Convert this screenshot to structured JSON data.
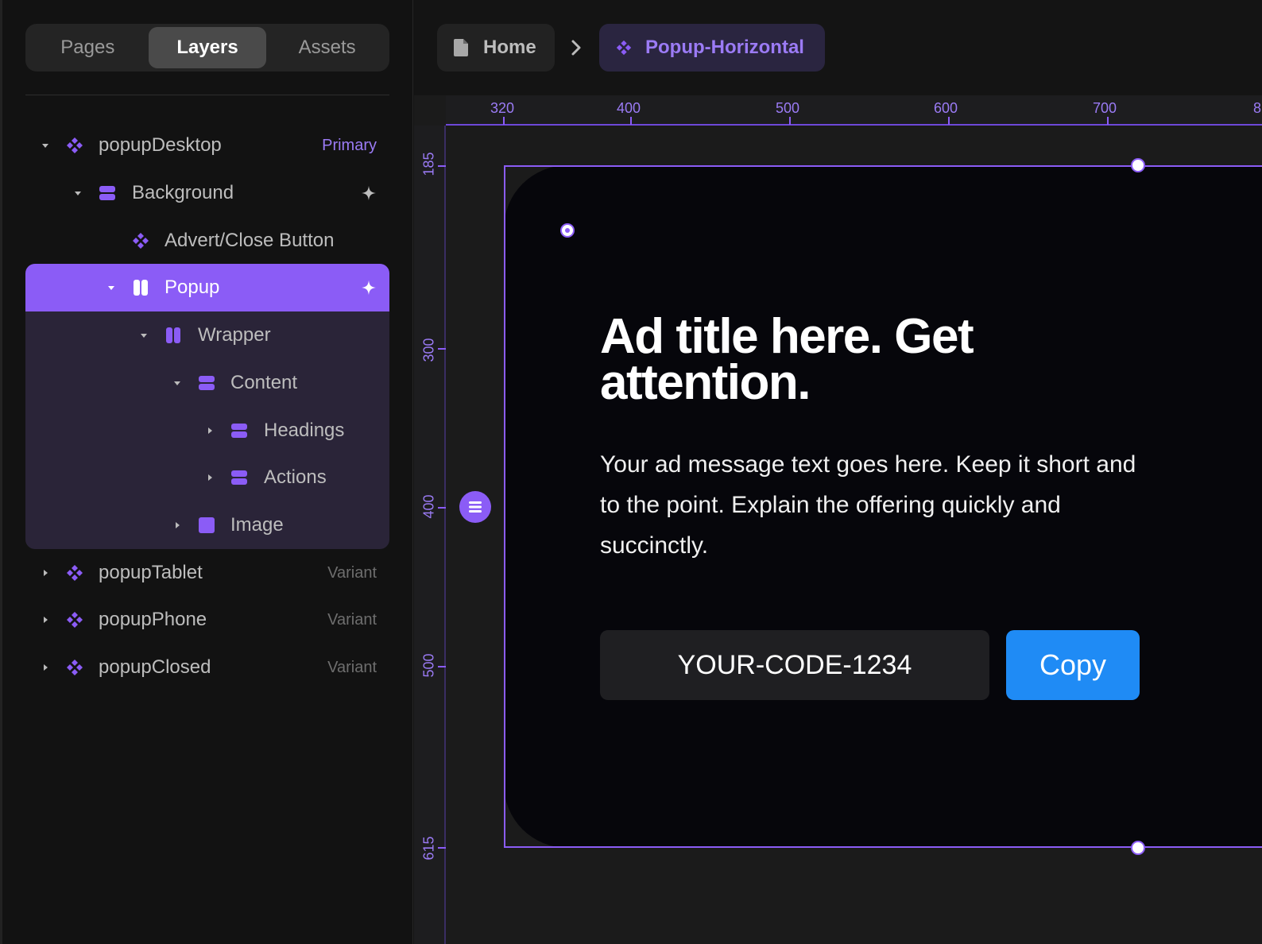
{
  "tabs": [
    "Pages",
    "Layers",
    "Assets"
  ],
  "active_tab": "Layers",
  "layers": [
    {
      "label": "popupDesktop",
      "badge": "Primary",
      "icon": "component-icon"
    },
    {
      "label": "Background",
      "icon": "stack-icon"
    },
    {
      "label": "Advert/Close Button",
      "icon": "component-icon"
    },
    {
      "label": "Popup",
      "icon": "columns-icon",
      "selected": true
    },
    {
      "label": "Wrapper",
      "icon": "columns-icon"
    },
    {
      "label": "Content",
      "icon": "stack-icon"
    },
    {
      "label": "Headings",
      "icon": "stack-icon"
    },
    {
      "label": "Actions",
      "icon": "stack-icon"
    },
    {
      "label": "Image",
      "icon": "frame-icon"
    },
    {
      "label": "popupTablet",
      "badge": "Variant",
      "icon": "component-icon"
    },
    {
      "label": "popupPhone",
      "badge": "Variant",
      "icon": "component-icon"
    },
    {
      "label": "popupClosed",
      "badge": "Variant",
      "icon": "component-icon"
    }
  ],
  "breadcrumb": {
    "home": "Home",
    "current": "Popup-Horizontal"
  },
  "ruler": {
    "top": [
      "320",
      "400",
      "500",
      "600",
      "700",
      "8"
    ],
    "left": [
      "185",
      "300",
      "400",
      "500",
      "615"
    ]
  },
  "ad": {
    "title": "Ad title here. Get attention.",
    "message": "Your ad message text goes here. Keep it short and to the point. Explain the offering quickly and succinctly.",
    "code": "YOUR-CODE-1234",
    "copy_label": "Copy"
  },
  "colors": {
    "accent": "#8b5cf6",
    "copy_button": "#1f8bf5",
    "selected_block": "#2a2438"
  }
}
